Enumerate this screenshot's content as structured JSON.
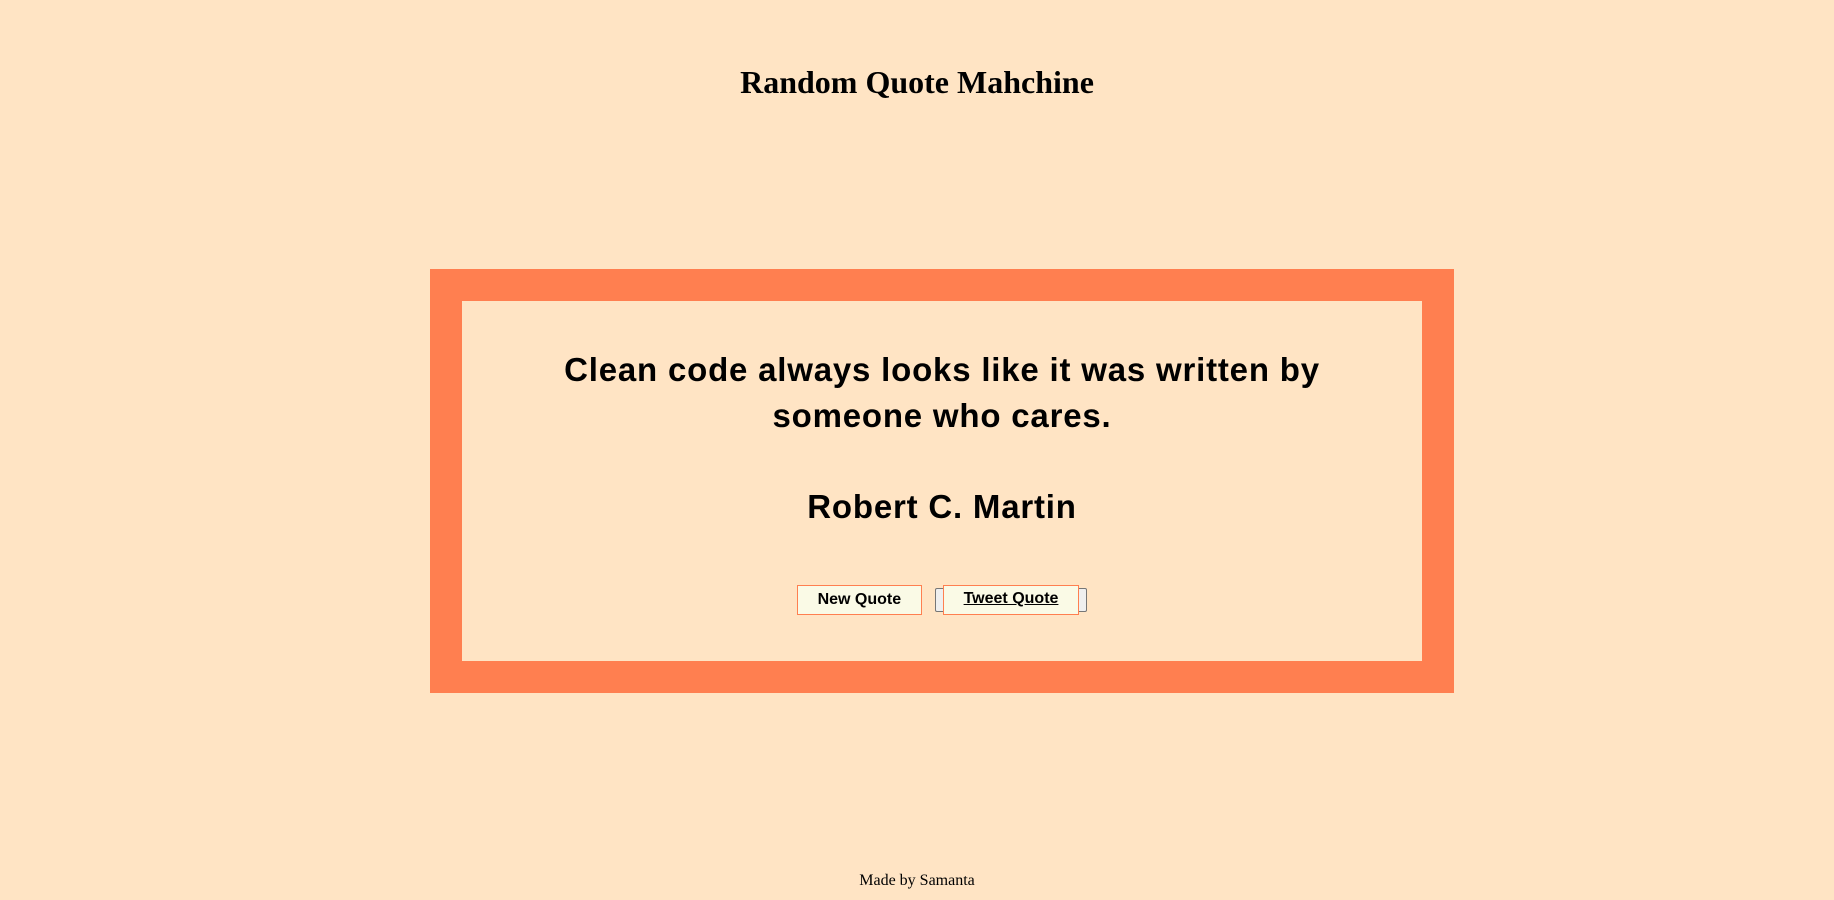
{
  "header": {
    "title": "Random Quote Mahchine"
  },
  "quote": {
    "text": "Clean code always looks like it was written by someone who cares.",
    "author": "Robert C. Martin"
  },
  "actions": {
    "new_quote_label": "New Quote",
    "tweet_quote_label": "Tweet Quote"
  },
  "footer": {
    "credit": "Made by Samanta"
  },
  "colors": {
    "background": "#ffe4c4",
    "frame": "#ff7f50",
    "button_bg": "#fafae6"
  }
}
